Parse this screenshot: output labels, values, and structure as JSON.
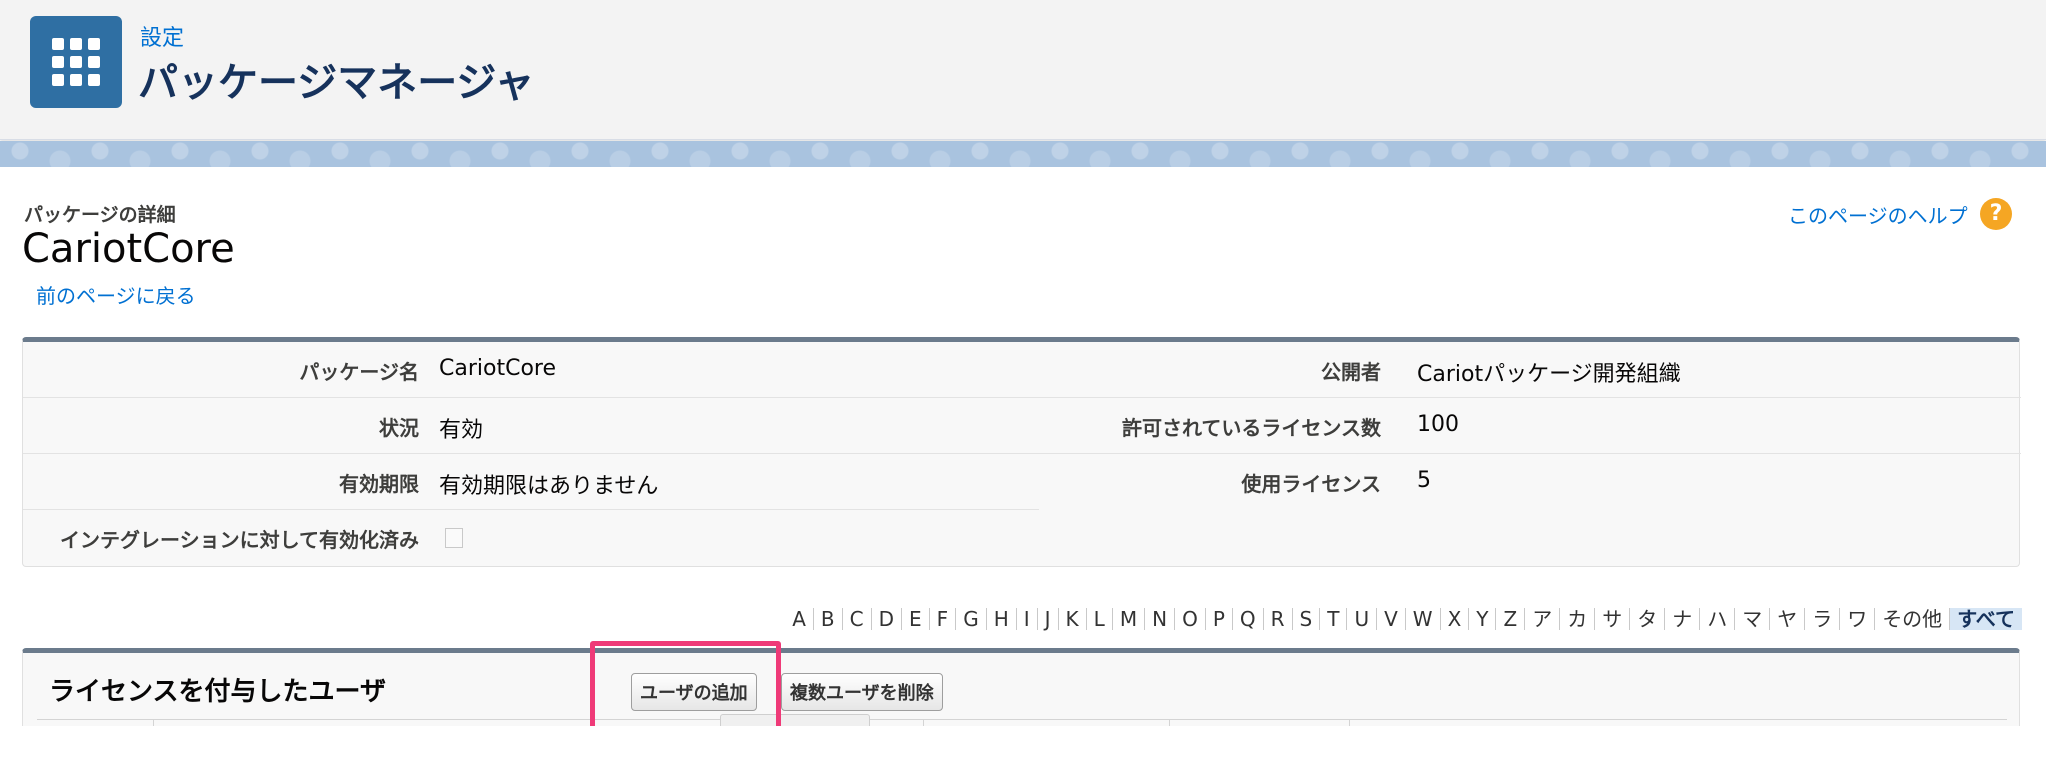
{
  "header": {
    "breadcrumb": "設定",
    "title": "パッケージマネージャ"
  },
  "record": {
    "sub_label": "パッケージの詳細",
    "name": "CariotCore",
    "back_link": "前のページに戻る",
    "help_link": "このページのヘルプ",
    "help_icon_char": "?"
  },
  "details": {
    "left": [
      {
        "label": "パッケージ名",
        "value": "CariotCore"
      },
      {
        "label": "状況",
        "value": "有効"
      },
      {
        "label": "有効期限",
        "value": "有効期限はありません"
      },
      {
        "label": "インテグレーションに対して有効化済み",
        "value": ""
      }
    ],
    "right": [
      {
        "label": "公開者",
        "value": "Cariotパッケージ開発組織"
      },
      {
        "label": "許可されているライセンス数",
        "value": "100"
      },
      {
        "label": "使用ライセンス",
        "value": "5"
      }
    ]
  },
  "alphabet": {
    "items": [
      "A",
      "B",
      "C",
      "D",
      "E",
      "F",
      "G",
      "H",
      "I",
      "J",
      "K",
      "L",
      "M",
      "N",
      "O",
      "P",
      "Q",
      "R",
      "S",
      "T",
      "U",
      "V",
      "W",
      "X",
      "Y",
      "Z",
      "ア",
      "カ",
      "サ",
      "タ",
      "ナ",
      "ハ",
      "マ",
      "ヤ",
      "ラ",
      "ワ",
      "その他",
      "すべて"
    ],
    "selected": "すべて"
  },
  "related": {
    "title": "ライセンスを付与したユーザ",
    "add_user_button": "ユーザの追加",
    "remove_users_button": "複数ユーザを削除"
  },
  "colors": {
    "highlight": "#ef3a78",
    "link": "#0070d2",
    "app_icon": "#2f6fa3"
  }
}
